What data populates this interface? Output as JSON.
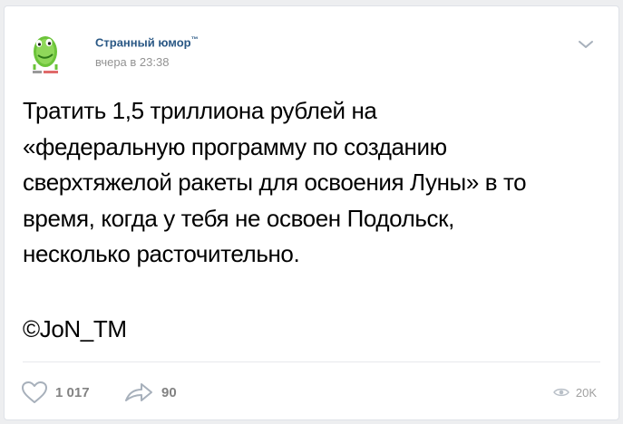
{
  "post": {
    "author": "Странный юмор",
    "author_mark": "™",
    "time": "вчера в 23:38",
    "text_lines": [
      "Тратить 1,5 триллиона рублей на",
      "«федеральную программу по созданию",
      "сверхтяжелой ракеты для освоения Луны» в то",
      "время, когда у тебя не освоен Подольск,",
      "несколько расточительно."
    ],
    "signature": "©JoN_TM",
    "likes": "1 017",
    "shares": "90",
    "views": "20K"
  },
  "icons": {
    "avatar": "green-monster-avatar",
    "menu": "chevron-down-icon",
    "like": "heart-icon",
    "share": "share-arrow-icon",
    "views": "eye-icon"
  },
  "colors": {
    "author": "#2a5885",
    "muted": "#939393",
    "icon": "#a7b0bb"
  }
}
